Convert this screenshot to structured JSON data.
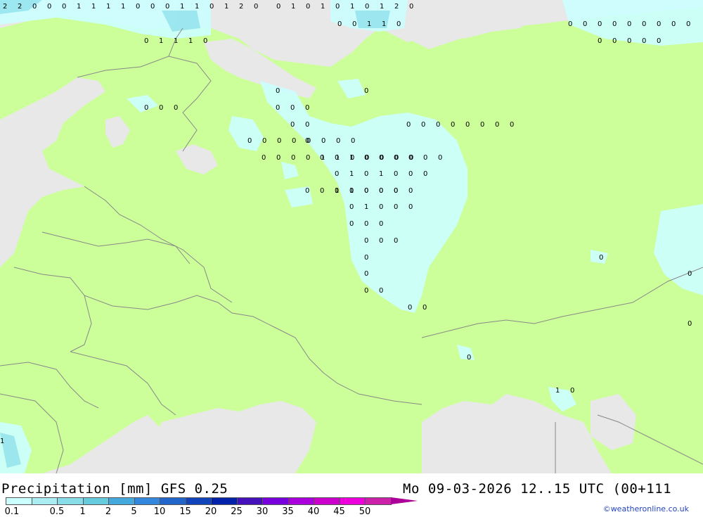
{
  "footer": {
    "title": "Precipitation [mm] GFS 0.25",
    "datetime": "Mo 09-03-2026 12..15 UTC (00+111",
    "credit": "©weatheronline.co.uk"
  },
  "legend": {
    "colors": [
      "#ccffff",
      "#aaeef4",
      "#88dde9",
      "#66ccdd",
      "#44aadd",
      "#3388dd",
      "#2266cc",
      "#1144bb",
      "#0022aa",
      "#4411bb",
      "#7700dd",
      "#aa00dd",
      "#cc00cc",
      "#ee00dd",
      "#cc22aa",
      "#aa0099"
    ],
    "labels": [
      "0.1",
      "0.5",
      "1",
      "2",
      "5",
      "10",
      "15",
      "20",
      "25",
      "30",
      "35",
      "40",
      "45",
      "50"
    ]
  },
  "map_colors": {
    "sea": "#e8e8e8",
    "land": "#ccff99",
    "precip_light": "#ccffff",
    "border": "#888888"
  },
  "map_values": {
    "top_row": [
      "2",
      "2",
      "0",
      "0",
      "0",
      "1",
      "1",
      "1",
      "1",
      "0",
      "0",
      "0",
      "1",
      "1",
      "0",
      "1",
      "2",
      "0"
    ],
    "grid": [
      [
        "0",
        "1",
        "0",
        "1",
        "0",
        "1",
        "0",
        "1",
        "2",
        "0"
      ],
      [
        "0",
        "0",
        "1",
        "1",
        "0"
      ],
      [
        "0",
        "1",
        "1",
        "1",
        "0"
      ],
      [
        "0",
        "0",
        "0",
        "0",
        "0",
        "0",
        "0",
        "0",
        "0",
        "0"
      ],
      [
        "0",
        "0",
        "0",
        "0",
        "0"
      ],
      [
        "0"
      ],
      [
        "0"
      ],
      [
        "0",
        "0",
        "0"
      ],
      [
        "0",
        "0",
        "0"
      ],
      [
        "0",
        "0"
      ],
      [
        "0",
        "0",
        "0",
        "0",
        "0",
        "0",
        "0",
        "0"
      ],
      [
        "0"
      ],
      [
        "0",
        "0",
        "0",
        "0",
        "0",
        "0",
        "0",
        "0"
      ],
      [
        "0",
        "0",
        "1",
        "0",
        "0",
        "0",
        "0",
        "0",
        "0"
      ],
      [
        "0",
        "0",
        "0",
        "0",
        "1",
        "1",
        "0",
        "0",
        "0",
        "0",
        "0"
      ],
      [
        "0",
        "1",
        "0",
        "1",
        "0",
        "0",
        "0"
      ],
      [
        "0",
        "0",
        "1",
        "0",
        "0",
        "0",
        "0",
        "0"
      ],
      [
        "0",
        "1",
        "0",
        "0",
        "0"
      ],
      [
        "0",
        "1",
        "0",
        "0",
        "0"
      ],
      [
        "0",
        "0",
        "0"
      ],
      [
        "0",
        "0",
        "0"
      ],
      [
        "0"
      ],
      [
        "0"
      ],
      [
        "0",
        "0"
      ],
      [
        "0",
        "0"
      ],
      [
        "0"
      ],
      [
        "0"
      ],
      [
        "0"
      ],
      [
        "0"
      ],
      [
        "1",
        "0"
      ],
      [
        "1"
      ]
    ]
  }
}
